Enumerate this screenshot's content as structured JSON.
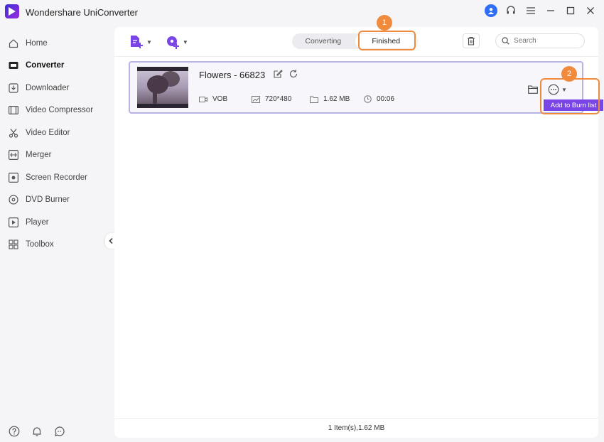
{
  "app": {
    "title": "Wondershare UniConverter"
  },
  "sidebar": {
    "items": [
      {
        "label": "Home",
        "icon": "home-icon"
      },
      {
        "label": "Converter",
        "icon": "converter-icon",
        "active": true
      },
      {
        "label": "Downloader",
        "icon": "download-icon"
      },
      {
        "label": "Video Compressor",
        "icon": "compress-icon"
      },
      {
        "label": "Video Editor",
        "icon": "scissors-icon"
      },
      {
        "label": "Merger",
        "icon": "merge-icon"
      },
      {
        "label": "Screen Recorder",
        "icon": "record-icon"
      },
      {
        "label": "DVD Burner",
        "icon": "disc-icon"
      },
      {
        "label": "Player",
        "icon": "play-icon"
      },
      {
        "label": "Toolbox",
        "icon": "grid-icon"
      }
    ]
  },
  "tabs": {
    "converting": "Converting",
    "finished": "Finished"
  },
  "search": {
    "placeholder": "Search"
  },
  "file": {
    "name": "Flowers - 66823",
    "format": "VOB",
    "resolution": "720*480",
    "size": "1.62 MB",
    "duration": "00:06"
  },
  "popup": {
    "add_to_burn": "Add to Burn list"
  },
  "annotations": {
    "badge1": "1",
    "badge2": "2"
  },
  "status": {
    "summary": "1 Item(s),1.62 MB"
  },
  "colors": {
    "accent": "#7a45e6",
    "highlight": "#f08a3c",
    "card_border": "#b8b3e6"
  }
}
